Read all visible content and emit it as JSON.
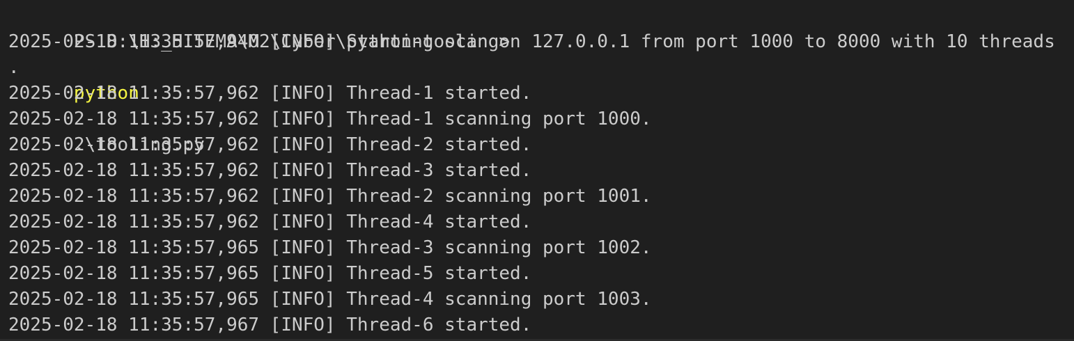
{
  "terminal": {
    "prompt_prefix": "PS D:\\H3_HITEMA\\M2\\Cyber\\python-tooling>",
    "command": "python",
    "command_arg": ".\\tooling.py",
    "lines": [
      "2025-02-18 11:35:57,940 [INFO] Starting scan on 127.0.0.1 from port 1000 to 8000 with 10 threads",
      ".",
      "2025-02-18 11:35:57,962 [INFO] Thread-1 started.",
      "2025-02-18 11:35:57,962 [INFO] Thread-1 scanning port 1000.",
      "2025-02-18 11:35:57,962 [INFO] Thread-2 started.",
      "2025-02-18 11:35:57,962 [INFO] Thread-3 started.",
      "2025-02-18 11:35:57,962 [INFO] Thread-2 scanning port 1001.",
      "2025-02-18 11:35:57,962 [INFO] Thread-4 started.",
      "2025-02-18 11:35:57,965 [INFO] Thread-3 scanning port 1002.",
      "2025-02-18 11:35:57,965 [INFO] Thread-5 started.",
      "2025-02-18 11:35:57,965 [INFO] Thread-4 scanning port 1003.",
      "2025-02-18 11:35:57,967 [INFO] Thread-6 started."
    ]
  },
  "colors": {
    "background": "#1f1f1f",
    "text": "#cccccc",
    "command": "#f5f543"
  }
}
